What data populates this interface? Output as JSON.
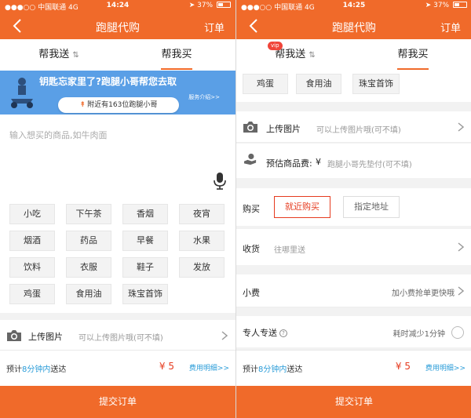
{
  "colors": {
    "brand": "#f06a2a",
    "price": "#e63b1f",
    "link": "#2a9cd8",
    "banner": "#5a9fe6"
  },
  "status_bar": {
    "carrier": "●●●○○ 中国联通",
    "network": "4G",
    "left": {
      "time": "14:24"
    },
    "right": {
      "time": "14:25"
    },
    "battery": "37%",
    "icons": [
      "signal-dots-icon",
      "location-arrow-icon",
      "alarm-icon",
      "bluetooth-icon",
      "battery-icon"
    ]
  },
  "nav": {
    "title": "跑腿代购",
    "order": "订单",
    "back_icon": "chevron-left-icon"
  },
  "tabs": {
    "send": "帮我送",
    "send_swap": "⇅",
    "buy": "帮我买",
    "vip": "vip"
  },
  "banner": {
    "slogan": "钥匙忘家里了?跑腿小哥帮您去取",
    "intro": "服务介绍>>",
    "nearby": "附近有163位跑腿小哥",
    "nearby_icon": "runner-icon"
  },
  "input": {
    "placeholder": "输入想买的商品,如牛肉面",
    "mic_icon": "microphone-icon"
  },
  "tags": [
    "小吃",
    "下午茶",
    "香烟",
    "夜宵",
    "烟酒",
    "药品",
    "早餐",
    "水果",
    "饮料",
    "衣服",
    "鞋子",
    "发放",
    "鸡蛋",
    "食用油",
    "珠宝首饰"
  ],
  "upload": {
    "label": "上传图片",
    "hint": "可以上传图片哦(可不填)",
    "icon": "camera-icon"
  },
  "est_fee": {
    "label": "预估商品费:",
    "currency": "¥",
    "hint": "跑腿小哥先垫付(可不填)",
    "icon": "hand-coin-icon"
  },
  "purchase": {
    "label": "购买",
    "nearby": "就近购买",
    "address": "指定地址"
  },
  "delivery": {
    "label": "收货",
    "placeholder": "往哪里送"
  },
  "tip": {
    "label": "小费",
    "hint": "加小费抢单更快哦"
  },
  "dedicated": {
    "label": "专人专送",
    "hint": "耗时减少1分钟"
  },
  "bottom": {
    "est_prefix": "预计",
    "est_time": "8分钟内",
    "est_suffix": "送达",
    "price": "¥ 5",
    "detail": "费用明细>>"
  },
  "submit": "提交订单"
}
